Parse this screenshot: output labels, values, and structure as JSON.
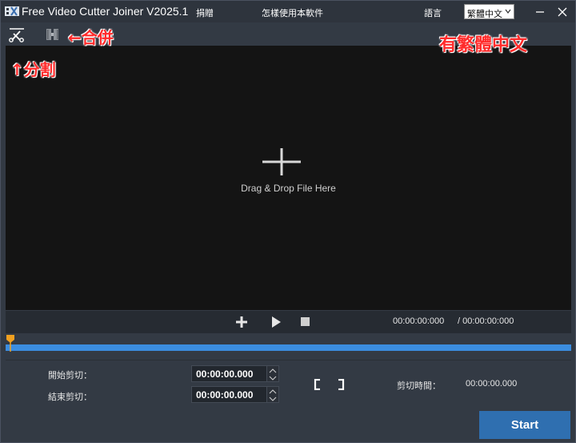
{
  "titlebar": {
    "app_title": "Free Video Cutter Joiner V2025.1",
    "donate": "捐贈",
    "how_to_use": "怎樣使用本軟件",
    "language_label": "語言",
    "language_selected": "繁體中文"
  },
  "annotations": {
    "join": "←合併",
    "split": "↑分割",
    "traditional": "有繁體中文"
  },
  "preview": {
    "drop_text": "Drag & Drop File Here"
  },
  "controls": {
    "current_time": "00:00:00:000",
    "total_time": "/ 00:00:00:000"
  },
  "timeline": {
    "progress": 0
  },
  "settings": {
    "start_label": "開始剪切：",
    "end_label": "結束剪切：",
    "start_value": "00:00:00.000",
    "end_value": "00:00:00.000",
    "duration_label": "剪切時間：",
    "duration_value": "00:00:00.000"
  },
  "actions": {
    "start": "Start"
  },
  "colors": {
    "accent": "#3b8de0",
    "start_button": "#2f6fb0",
    "playhead": "#f0a020",
    "annotation": "#ff2a2a"
  }
}
